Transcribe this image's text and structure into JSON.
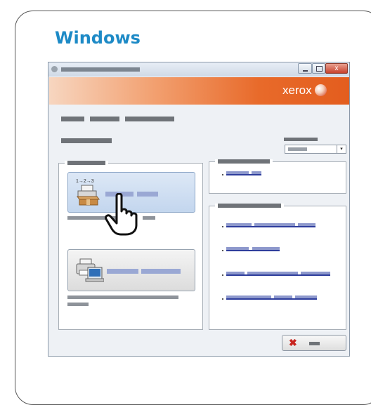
{
  "heading": {
    "title": "Windows"
  },
  "window": {
    "close_glyph": "x",
    "logo_text": "xerox",
    "select_arrow": "▾"
  },
  "install_button": {
    "step_label": "1→2→3"
  },
  "cancel_button": {
    "icon_glyph": "✖"
  },
  "colors": {
    "title_blue": "#1d8ac6",
    "banner_orange": "#e35d1e",
    "link_blue": "#2e3d9c",
    "cancel_red": "#c8231e"
  },
  "icons": [
    "window-app-icon",
    "minimize-icon",
    "maximize-icon",
    "close-icon",
    "xerox-logo-icon",
    "printer-box-icon",
    "pointing-hand-icon",
    "printer-computer-icon",
    "cancel-x-icon",
    "dropdown-arrow-icon"
  ]
}
